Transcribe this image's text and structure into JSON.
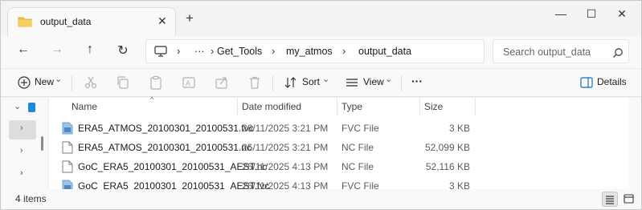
{
  "tab": {
    "title": "output_data",
    "close": "✕",
    "new_tab": "+"
  },
  "window_controls": {
    "minimize": "—",
    "maximize": "☐",
    "close": "✕"
  },
  "nav": {
    "back": "←",
    "forward": "→",
    "up": "↑",
    "refresh": "↻"
  },
  "address": {
    "crumbs": [
      "Get_Tools",
      "my_atmos",
      "output_data"
    ],
    "ellipsis": "···",
    "sep": "›"
  },
  "search": {
    "placeholder": "Search output_data"
  },
  "commands": {
    "new_label": "New",
    "sort_label": "Sort",
    "view_label": "View",
    "more_label": "···",
    "details_label": "Details",
    "chevron": "⌄"
  },
  "columns": {
    "name": "Name",
    "date": "Date modified",
    "type": "Type",
    "size": "Size",
    "sort_indicator": "^"
  },
  "files": [
    {
      "name": "ERA5_ATMOS_20100301_20100531.fvc",
      "date": "26/11/2025 3:21 PM",
      "type": "FVC File",
      "size": "3 KB",
      "icon": "fvc-file-icon"
    },
    {
      "name": "ERA5_ATMOS_20100301_20100531.nc",
      "date": "26/11/2025 3:21 PM",
      "type": "NC File",
      "size": "52,099 KB",
      "icon": "nc-file-icon"
    },
    {
      "name": "GoC_ERA5_20100301_20100531_AEST.nc",
      "date": "26/11/2025 4:13 PM",
      "type": "NC File",
      "size": "52,116 KB",
      "icon": "nc-file-icon"
    },
    {
      "name": "GoC_ERA5_20100301_20100531_AEST.fvc",
      "date": "26/11/2025 4:13 PM",
      "type": "FVC File",
      "size": "3 KB",
      "icon": "fvc-file-icon"
    }
  ],
  "navpane": {
    "chevron_down": "⌄",
    "chevron_right": "›"
  },
  "status": {
    "item_count": "4 items"
  },
  "colors": {
    "accent": "#1a8ad8",
    "folder": "#f2c04d"
  }
}
